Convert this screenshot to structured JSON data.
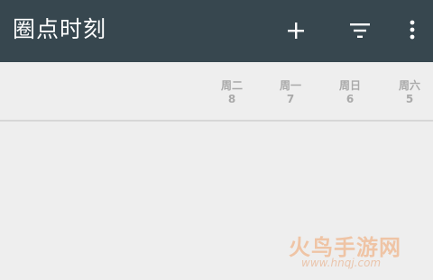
{
  "colors": {
    "toolbar_bg": "#37474f",
    "toolbar_fg": "#ffffff",
    "page_bg": "#eeeeee",
    "header_text": "#a9a9a9",
    "divider": "#d7d7d7",
    "watermark": "#f0a36b"
  },
  "toolbar": {
    "title": "圈点时刻",
    "add_icon": "plus-icon",
    "filter_icon": "filter-icon",
    "more_icon": "more-vert-icon"
  },
  "days": [
    {
      "name": "周二",
      "num": "8"
    },
    {
      "name": "周一",
      "num": "7"
    },
    {
      "name": "周日",
      "num": "6"
    },
    {
      "name": "周六",
      "num": "5"
    }
  ],
  "watermark": {
    "main": "火鸟手游网",
    "sub": "www.hnqj.com"
  }
}
